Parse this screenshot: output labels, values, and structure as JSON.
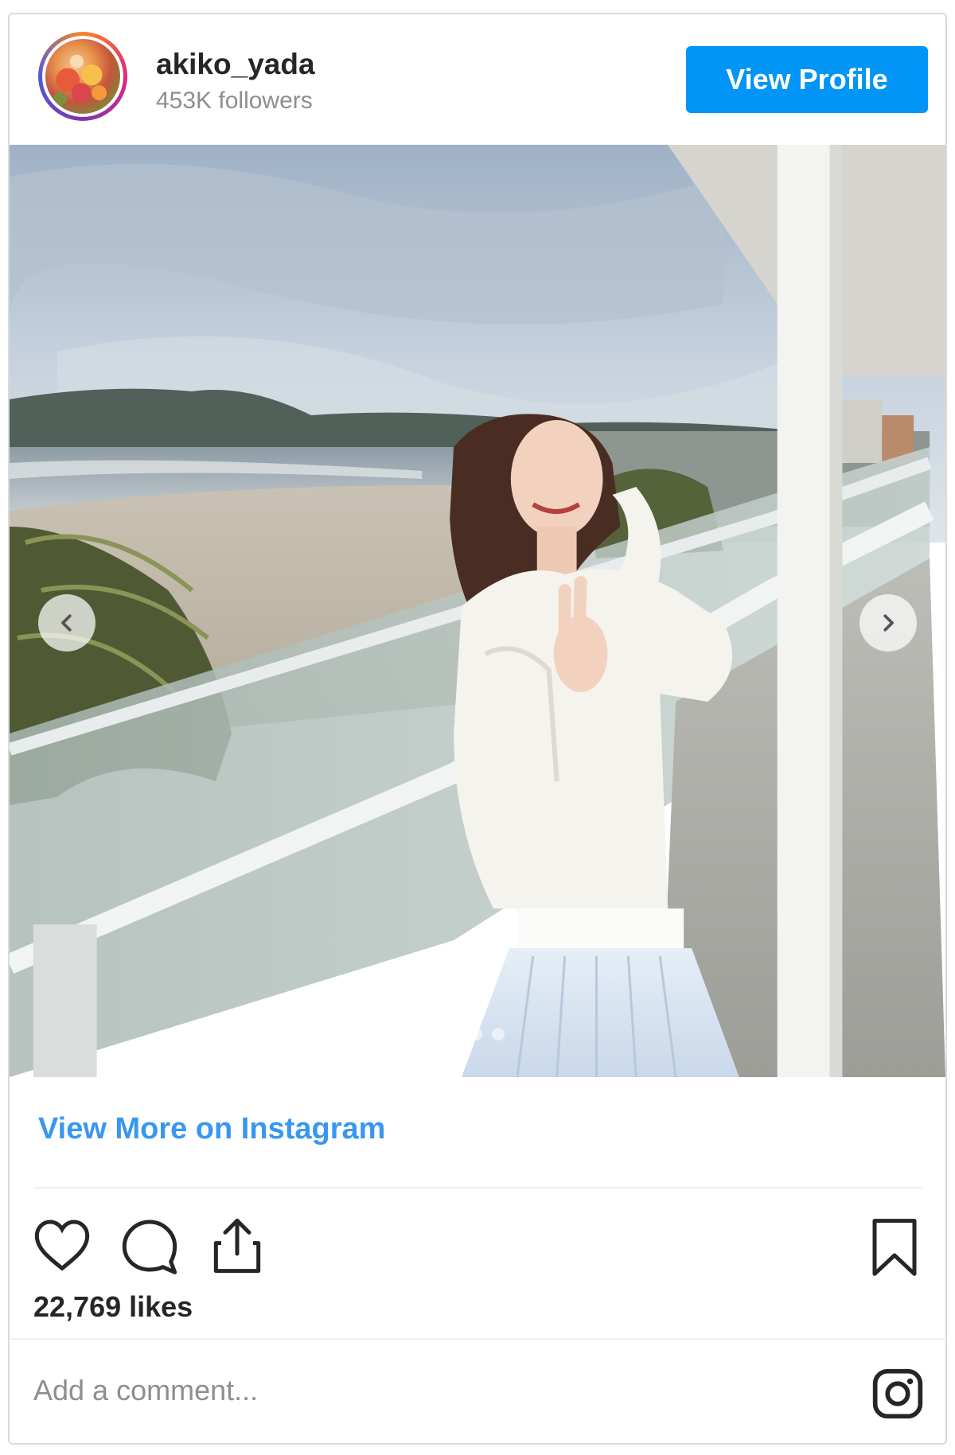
{
  "header": {
    "username": "akiko_yada",
    "followers": "453K followers",
    "view_profile_label": "View Profile"
  },
  "post": {
    "carousel_total": 5,
    "carousel_active": 2,
    "view_more_label": "View More on Instagram",
    "likes": "22,769 likes",
    "comment_placeholder": "Add a comment..."
  },
  "icons": {
    "like": "heart-icon",
    "comment": "comment-bubble-icon",
    "share": "share-icon",
    "save": "bookmark-icon",
    "brand": "instagram-logo-icon",
    "prev": "chevron-left-icon",
    "next": "chevron-right-icon"
  },
  "colors": {
    "accent": "#0095f6",
    "link": "#3897f0",
    "text": "#262626",
    "muted": "#8e8e8e",
    "border": "#dbdbdb"
  }
}
